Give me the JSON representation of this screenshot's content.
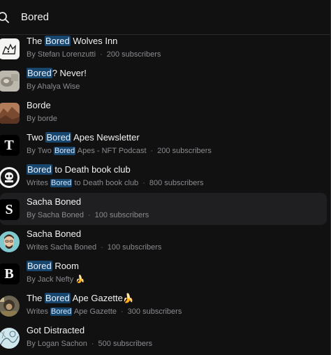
{
  "search": {
    "query": "Bored",
    "highlight": "Bored"
  },
  "results": [
    {
      "title": [
        "The ",
        "Bored",
        " Wolves Inn"
      ],
      "sub": [
        "By Stefan Lorenzutti"
      ],
      "subscribers": "200 subscribers",
      "thumb": "wolf-sketch"
    },
    {
      "title": [
        "",
        "Bored",
        "? Never!"
      ],
      "sub": [
        "By Ahalya Wise"
      ],
      "subscribers": "",
      "thumb": "grey-photo"
    },
    {
      "title": [
        "Borde"
      ],
      "sub": [
        "By borde"
      ],
      "subscribers": "",
      "thumb": "brown-photo"
    },
    {
      "title": [
        "Two ",
        "Bored",
        " Apes Newsletter"
      ],
      "sub": [
        "By Two ",
        "Bored",
        " Apes - NFT Podcast"
      ],
      "subscribers": "200 subscribers",
      "thumb": "letter-T"
    },
    {
      "title": [
        "",
        "Bored",
        " to Death book club"
      ],
      "sub": [
        "Writes ",
        "Bored",
        " to Death book club"
      ],
      "subscribers": "800 subscribers",
      "thumb": "skull-badge"
    },
    {
      "title": [
        "Sacha Boned"
      ],
      "sub": [
        "By Sacha Boned"
      ],
      "subscribers": "100 subscribers",
      "thumb": "letter-S"
    },
    {
      "title": [
        "Sacha Boned"
      ],
      "sub": [
        "Writes Sacha Boned"
      ],
      "subscribers": "100 subscribers",
      "thumb": "avatar-man"
    },
    {
      "title": [
        "",
        "Bored",
        " Room"
      ],
      "sub": [
        "By Jack Nefty 🍌"
      ],
      "subscribers": "",
      "thumb": "letter-B"
    },
    {
      "title": [
        "The ",
        "Bored",
        " Ape Gazette🍌"
      ],
      "sub": [
        "Writes ",
        "Bored",
        " Ape Gazette"
      ],
      "subscribers": "300 subscribers",
      "thumb": "ape-photo"
    },
    {
      "title": [
        "Got Distracted"
      ],
      "sub": [
        "By Logan Sachon"
      ],
      "subscribers": "500 subscribers",
      "thumb": "sketch-photo"
    }
  ],
  "selected_index": 5,
  "letters": {
    "T": "T",
    "S": "S",
    "B": "B"
  }
}
